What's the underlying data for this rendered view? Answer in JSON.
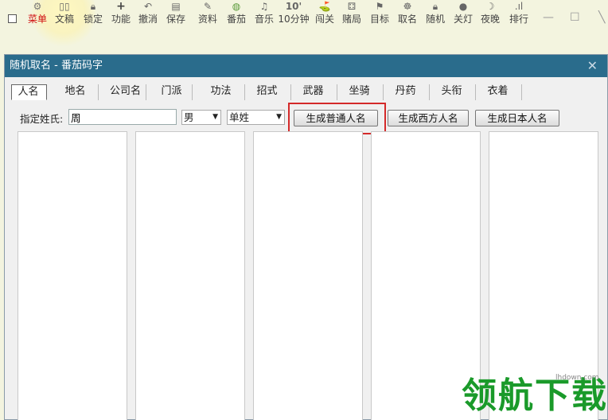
{
  "toolbar": {
    "items": [
      {
        "label": "菜单",
        "icon": "⚙"
      },
      {
        "label": "文稿",
        "icon": "📖"
      },
      {
        "label": "锁定",
        "icon": "🔒"
      },
      {
        "label": "功能",
        "icon": "+"
      },
      {
        "label": "撤消",
        "icon": "↶"
      },
      {
        "label": "保存",
        "icon": "▤"
      },
      {
        "label": "资料",
        "icon": "✎"
      },
      {
        "label": "番茄",
        "icon": "◍"
      },
      {
        "label": "音乐",
        "icon": "♫"
      },
      {
        "label": "10分钟",
        "icon": "10'"
      },
      {
        "label": "闯关",
        "icon": "⛳"
      },
      {
        "label": "赌局",
        "icon": "⚃"
      },
      {
        "label": "目标",
        "icon": "⚑"
      },
      {
        "label": "取名",
        "icon": "☸"
      },
      {
        "label": "随机",
        "icon": "🔒"
      },
      {
        "label": "关灯",
        "icon": "●"
      },
      {
        "label": "夜晚",
        "icon": "☽"
      },
      {
        "label": "排行",
        "icon": ".ıl"
      }
    ],
    "minimize": "—",
    "maximize": "☐",
    "close": "╲"
  },
  "dialog": {
    "title": "随机取名 - 番茄码字",
    "close": "✕",
    "tabs": [
      "人名",
      "地名",
      "公司名",
      "门派",
      "功法",
      "招式",
      "武器",
      "坐骑",
      "丹药",
      "头衔",
      "衣着"
    ],
    "active_tab": "人名",
    "surname_label": "指定姓氏:",
    "surname_value": "周",
    "gender_value": "男",
    "surname_type_value": "单姓",
    "btn_common": "生成普通人名",
    "btn_western": "生成西方人名",
    "btn_japanese": "生成日本人名"
  },
  "watermark": {
    "text": "领航下载",
    "url": "lhdown.com"
  }
}
